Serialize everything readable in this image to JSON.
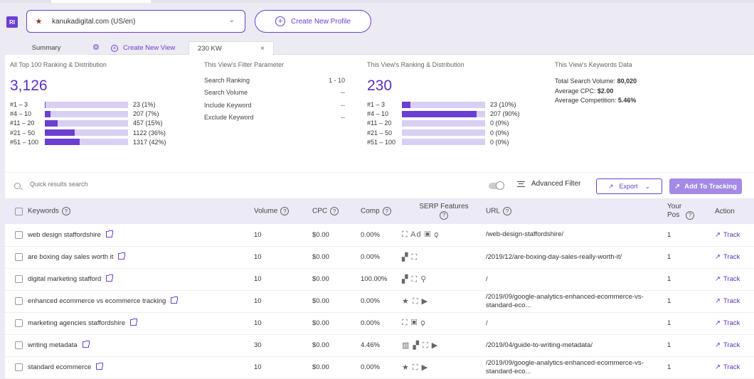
{
  "header": {
    "logo": "RI",
    "domain": "kanukadigital.com (US/en)",
    "create_profile": "Create New Profile"
  },
  "tabs": {
    "summary": "Summary",
    "create_view": "Create New View",
    "active": "230 KW",
    "close": "×"
  },
  "stats": {
    "all": {
      "title": "All Top 100 Ranking & Distribution",
      "total": "3,126",
      "rows": [
        {
          "label": "#1 – 3",
          "value": "23 (1%)",
          "fraction": 0.01
        },
        {
          "label": "#4 – 10",
          "value": "207 (7%)",
          "fraction": 0.07
        },
        {
          "label": "#11 – 20",
          "value": "457 (15%)",
          "fraction": 0.15
        },
        {
          "label": "#21 – 50",
          "value": "1122 (36%)",
          "fraction": 0.36
        },
        {
          "label": "#51 – 100",
          "value": "1317 (42%)",
          "fraction": 0.42
        }
      ]
    },
    "filter": {
      "title": "This View's Filter Parameter",
      "rows": [
        {
          "label": "Search Ranking",
          "value": "1 - 10"
        },
        {
          "label": "Search Volume",
          "value": "--"
        },
        {
          "label": "Include Keyword",
          "value": "--"
        },
        {
          "label": "Exclude Keyword",
          "value": "--"
        }
      ]
    },
    "view": {
      "title": "This View's Ranking & Distribution",
      "total": "230",
      "rows": [
        {
          "label": "#1 – 3",
          "value": "23 (10%)",
          "fraction": 0.1
        },
        {
          "label": "#4 – 10",
          "value": "207 (90%)",
          "fraction": 0.9
        },
        {
          "label": "#11 – 20",
          "value": "0 (0%)",
          "fraction": 0
        },
        {
          "label": "#21 – 50",
          "value": "0 (0%)",
          "fraction": 0
        },
        {
          "label": "#51 – 100",
          "value": "0 (0%)",
          "fraction": 0
        }
      ]
    },
    "keywords": {
      "title": "This View's Keywords Data",
      "volume_label": "Total Search Volume:",
      "volume": "80,020",
      "cpc_label": "Average CPC:",
      "cpc": "$2.00",
      "comp_label": "Average Competition:",
      "comp": "5.46%"
    }
  },
  "toolbar": {
    "search_placeholder": "Quick results search",
    "advanced_filter": "Advanced Filter",
    "export": "Export",
    "add_tracking": "Add To Tracking"
  },
  "table": {
    "headers": {
      "keywords": "Keywords",
      "volume": "Volume",
      "cpc": "CPC",
      "comp": "Comp",
      "serp": "SERP Features",
      "url": "URL",
      "pos": "Your Pos",
      "action": "Action"
    },
    "rows": [
      {
        "keyword": "web design staffordshire",
        "volume": "10",
        "cpc": "$0.00",
        "comp": "0.00%",
        "serp": "⛶ Ad ▣ ⚲",
        "url": "/web-design-staffordshire/",
        "pos": "1",
        "action": "Track"
      },
      {
        "keyword": "are boxing day sales worth it",
        "volume": "10",
        "cpc": "$0.00",
        "comp": "0.00%",
        "serp": "▞ ⛶",
        "url": "/2019/12/are-boxing-day-sales-really-worth-it/",
        "pos": "1",
        "action": "Track"
      },
      {
        "keyword": "digital marketing stafford",
        "volume": "10",
        "cpc": "$0.00",
        "comp": "100.00%",
        "serp": "▞ ⛶ ⚲",
        "url": "/",
        "pos": "1",
        "action": "Track"
      },
      {
        "keyword": "enhanced ecommerce vs ecommerce tracking",
        "volume": "10",
        "cpc": "$0.00",
        "comp": "0.00%",
        "serp": "★ ⛶ ▶",
        "url": "/2019/09/google-analytics-enhanced-ecommerce-vs-standard-eco...",
        "pos": "1",
        "action": "Track"
      },
      {
        "keyword": "marketing agencies staffordshire",
        "volume": "10",
        "cpc": "$0.00",
        "comp": "0.00%",
        "serp": "⛶ ▣ ⚲",
        "url": "/",
        "pos": "1",
        "action": "Track"
      },
      {
        "keyword": "writing metadata",
        "volume": "30",
        "cpc": "$0.00",
        "comp": "4.46%",
        "serp": "▥ ▞ ⛶ ▶",
        "url": "/2019/04/guide-to-writing-metadata/",
        "pos": "1",
        "action": "Track"
      },
      {
        "keyword": "standard ecommerce",
        "volume": "10",
        "cpc": "$0.00",
        "comp": "0.00%",
        "serp": "★ ⛶ ▶",
        "url": "/2019/09/google-analytics-enhanced-ecommerce-vs-standard-eco...",
        "pos": "1",
        "action": "Track"
      }
    ]
  },
  "colors": {
    "accent": "#6b3fd1",
    "bar_bg": "#d9cff5",
    "header_bg": "#eceaf6"
  }
}
